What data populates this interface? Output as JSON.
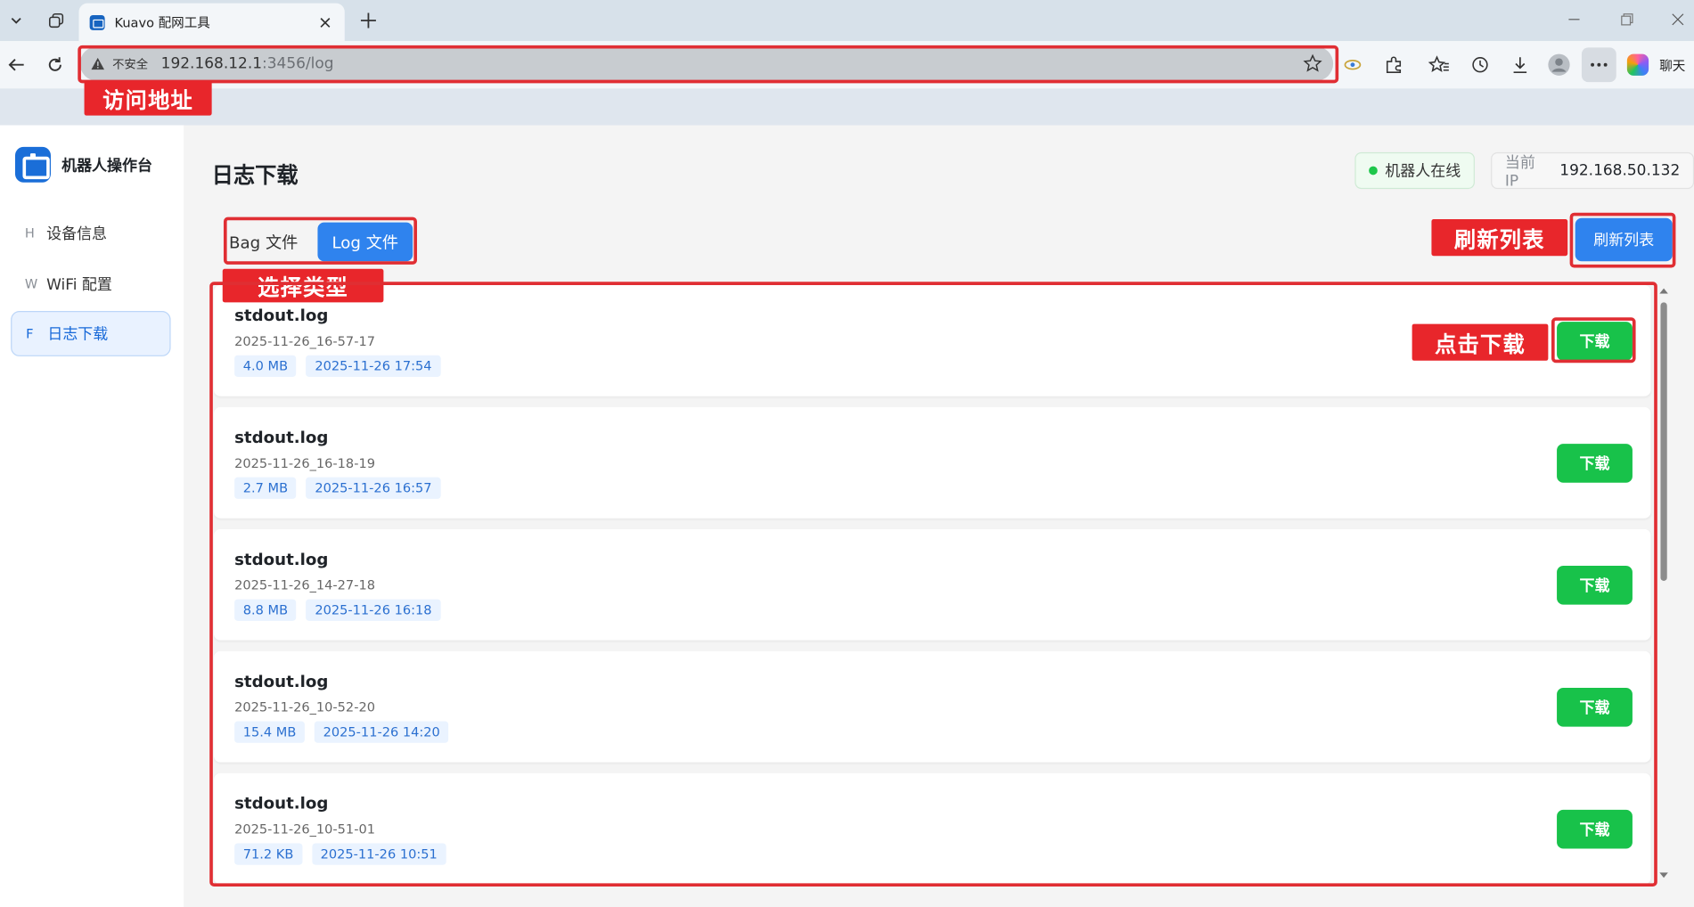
{
  "browser": {
    "tab_title": "Kuavo 配网工具",
    "address": {
      "insecure_label": "不安全",
      "url_host": "192.168.12.1",
      "url_path": ":3456/log"
    },
    "copilot_label": "聊天"
  },
  "annotations": {
    "address_callout": "访问地址",
    "type_callout": "选择类型",
    "refresh_callout": "刷新列表",
    "download_callout": "点击下载",
    "box_color": "#e02e33"
  },
  "sidebar": {
    "brand_name": "机器人操作台",
    "items": [
      {
        "key": "H",
        "label": "设备信息"
      },
      {
        "key": "W",
        "label": "WiFi 配置"
      },
      {
        "key": "F",
        "label": "日志下载",
        "active": true
      }
    ]
  },
  "header": {
    "title": "日志下载",
    "status": "机器人在线",
    "status_color": "#1ec74b",
    "ip_label": "当前 IP",
    "ip_value": "192.168.50.132"
  },
  "toolbar": {
    "bag_tab": "Bag 文件",
    "log_tab": "Log 文件",
    "selected_tab": "Log 文件",
    "refresh_label": "刷新列表",
    "accent_color": "#2f83ee"
  },
  "files": [
    {
      "name": "stdout.log",
      "stamp": "2025-11-26_16-57-17",
      "size": "4.0 MB",
      "time": "2025-11-26 17:54",
      "action": "下载"
    },
    {
      "name": "stdout.log",
      "stamp": "2025-11-26_16-18-19",
      "size": "2.7 MB",
      "time": "2025-11-26 16:57",
      "action": "下载"
    },
    {
      "name": "stdout.log",
      "stamp": "2025-11-26_14-27-18",
      "size": "8.8 MB",
      "time": "2025-11-26 16:18",
      "action": "下载"
    },
    {
      "name": "stdout.log",
      "stamp": "2025-11-26_10-52-20",
      "size": "15.4 MB",
      "time": "2025-11-26 14:20",
      "action": "下载"
    },
    {
      "name": "stdout.log",
      "stamp": "2025-11-26_10-51-01",
      "size": "71.2 KB",
      "time": "2025-11-26 10:51",
      "action": "下载"
    }
  ],
  "download_color": "#18c24a"
}
